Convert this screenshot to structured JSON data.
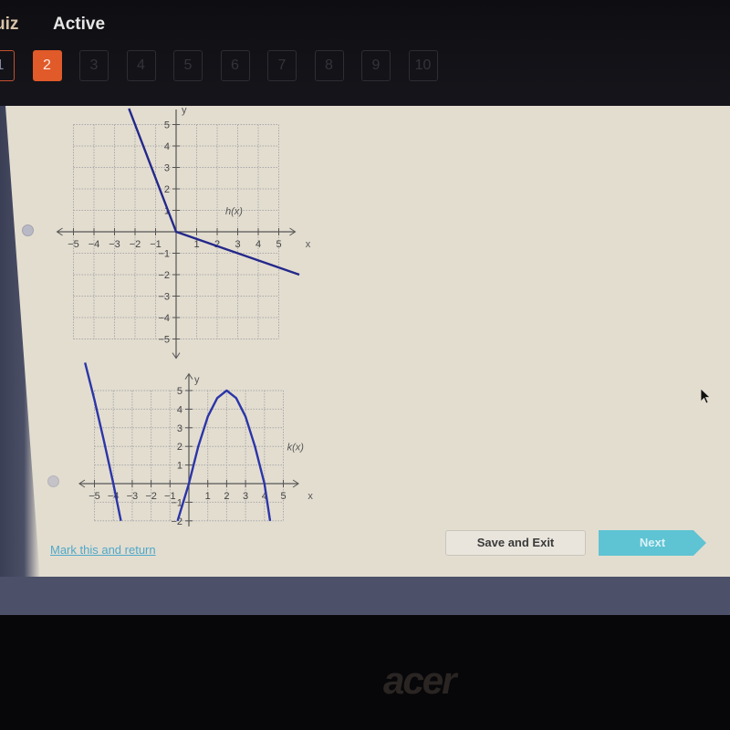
{
  "header": {
    "quiz_label": "uiz",
    "status": "Active"
  },
  "question_nav": {
    "items": [
      {
        "label": "1",
        "state": "done"
      },
      {
        "label": "2",
        "state": "current"
      },
      {
        "label": "3",
        "state": "locked"
      },
      {
        "label": "4",
        "state": "locked"
      },
      {
        "label": "5",
        "state": "locked"
      },
      {
        "label": "6",
        "state": "locked"
      },
      {
        "label": "7",
        "state": "locked"
      },
      {
        "label": "8",
        "state": "locked"
      },
      {
        "label": "9",
        "state": "locked"
      },
      {
        "label": "10",
        "state": "locked"
      }
    ],
    "current_color": "#e05a2a"
  },
  "options": [
    {
      "selected": false,
      "graph_index": 0
    },
    {
      "selected": false,
      "graph_index": 1
    }
  ],
  "chart_data": [
    {
      "type": "line",
      "title": "",
      "function_label": "h(x)",
      "xlabel": "x",
      "ylabel": "y",
      "xlim": [
        -5,
        5
      ],
      "ylim": [
        -5,
        5
      ],
      "x_ticks": [
        "-5",
        "-4",
        "-3",
        "-2",
        "-1",
        "1",
        "2",
        "3",
        "4",
        "5"
      ],
      "y_ticks": [
        "5",
        "4",
        "3",
        "2",
        "1",
        "-1",
        "-2",
        "-3",
        "-4",
        "-5"
      ],
      "grid": true,
      "series": [
        {
          "name": "h(x)",
          "color": "#23288a",
          "x": [
            -2.3,
            0,
            6.0
          ],
          "y": [
            5.75,
            0,
            -2.0
          ]
        }
      ]
    },
    {
      "type": "line",
      "title": "",
      "function_label": "k(x)",
      "xlabel": "x",
      "ylabel": "y",
      "xlim": [
        -5,
        5
      ],
      "ylim": [
        -2,
        5
      ],
      "x_ticks": [
        "-5",
        "-4",
        "-3",
        "-2",
        "-1",
        "1",
        "2",
        "3",
        "4",
        "5"
      ],
      "y_ticks": [
        "5",
        "4",
        "3",
        "2",
        "1",
        "-1",
        "-2"
      ],
      "grid": true,
      "series": [
        {
          "name": "k(x)",
          "color": "#2b35a8",
          "x": [
            -5.5,
            -5.0,
            -4.5,
            -4.0,
            -3.6,
            -0.6,
            -0.3,
            0,
            0.5,
            1.0,
            1.5,
            2.0,
            2.5,
            3.0,
            3.5,
            4.0,
            4.3
          ],
          "y": [
            6.5,
            4.5,
            2.3,
            0,
            -2.0,
            -2.0,
            -1.0,
            0,
            2.0,
            3.6,
            4.6,
            5.0,
            4.6,
            3.6,
            2.0,
            0,
            -2.0
          ]
        }
      ]
    }
  ],
  "footer": {
    "mark_link": "Mark this and return",
    "save_exit": "Save and Exit",
    "next": "Next"
  },
  "device": {
    "brand": "acer"
  }
}
